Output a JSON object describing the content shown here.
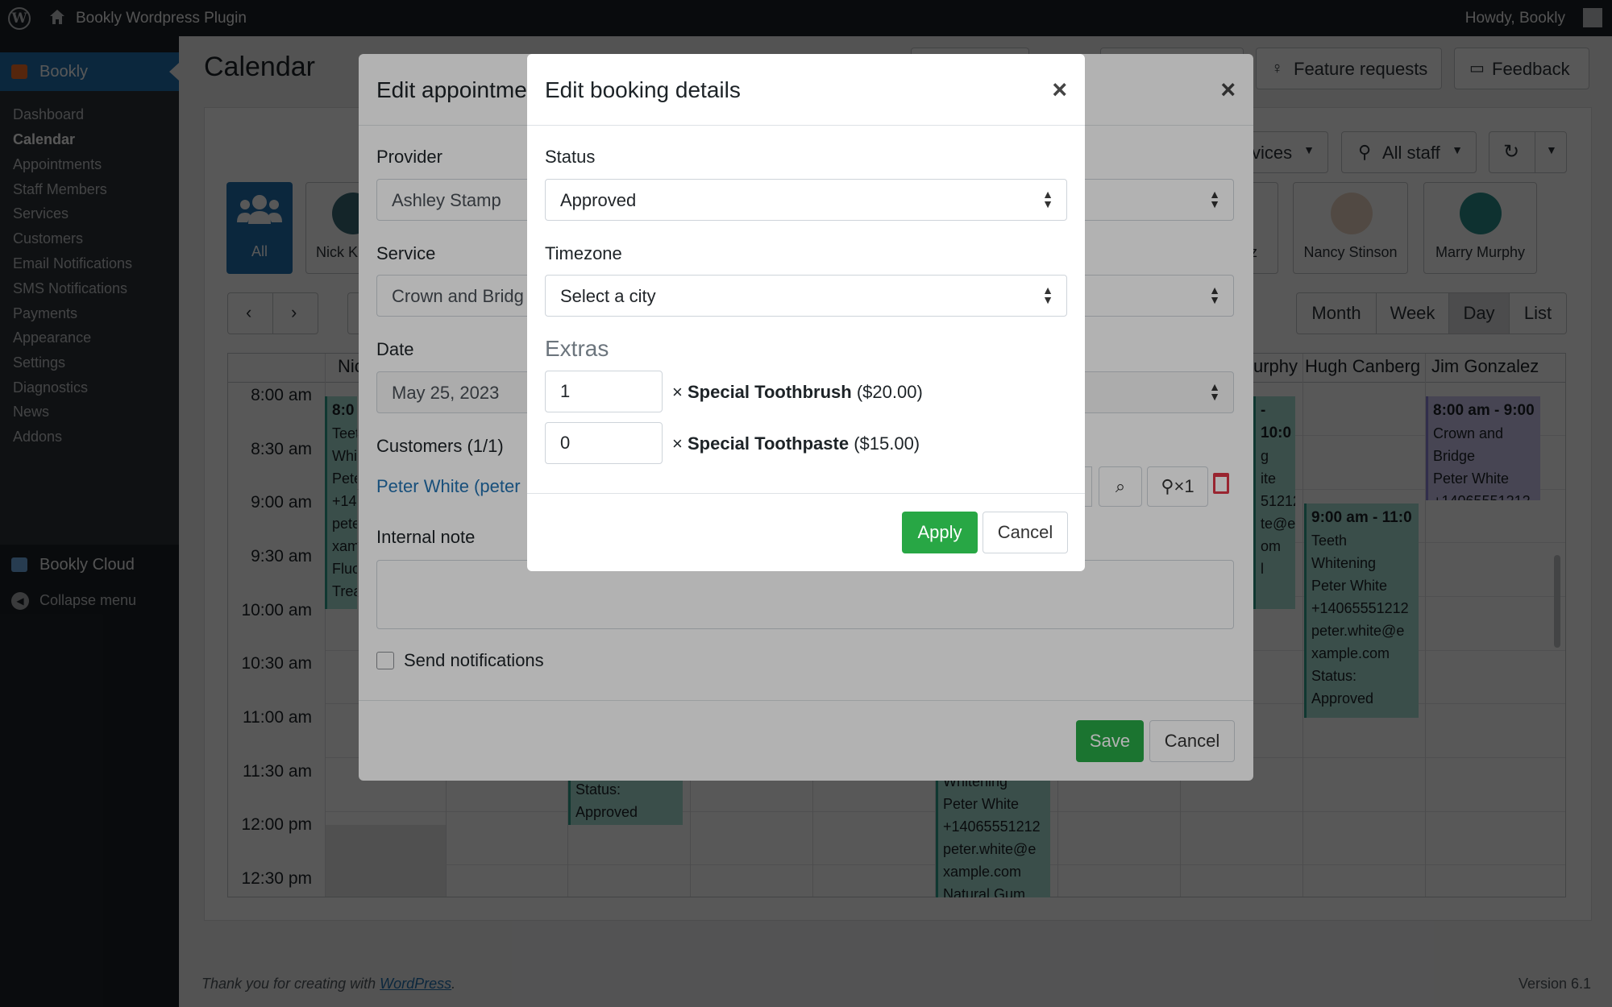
{
  "adminbar": {
    "site_name": "Bookly Wordpress Plugin",
    "howdy": "Howdy, Bookly"
  },
  "sidebar": {
    "active_menu": "Bookly",
    "items": [
      {
        "label": "Dashboard"
      },
      {
        "label": "Calendar",
        "current": true
      },
      {
        "label": "Appointments"
      },
      {
        "label": "Staff Members"
      },
      {
        "label": "Services"
      },
      {
        "label": "Customers"
      },
      {
        "label": "Email Notifications"
      },
      {
        "label": "SMS Notifications"
      },
      {
        "label": "Payments"
      },
      {
        "label": "Appearance"
      },
      {
        "label": "Settings"
      },
      {
        "label": "Diagnostics"
      },
      {
        "label": "News"
      },
      {
        "label": "Addons"
      }
    ],
    "cloud": "Bookly Cloud",
    "collapse": "Collapse menu"
  },
  "page": {
    "title": "Calendar",
    "feature_requests": "Feature requests",
    "feedback": "Feedback"
  },
  "calendar": {
    "filters": {
      "services_partial": "vices",
      "staff": "All staff"
    },
    "staff": {
      "all": "All",
      "nick_partial": "Nick K",
      "jim_partial": "ez",
      "nancy": "Nancy Stinson",
      "marry": "Marry Murphy"
    },
    "views": [
      "Month",
      "Week",
      "Day",
      "List"
    ],
    "active_view": "Day",
    "columns": {
      "nick_partial": "Nic",
      "murphy_partial": "urphy",
      "hugh": "Hugh Canberg",
      "jim": "Jim Gonzalez"
    },
    "times": [
      "8:00 am",
      "8:30 am",
      "9:00 am",
      "9:30 am",
      "10:00 am",
      "10:30 am",
      "11:00 am",
      "11:30 am",
      "12:00 pm",
      "12:30 pm"
    ],
    "appointments": {
      "a1": [
        "8:0",
        "Teet",
        "Whit",
        "Pete",
        "+140",
        "pete",
        "xam",
        "Fluo",
        "Trea"
      ],
      "a2": [
        "- 10:0",
        "g",
        "ite",
        "51212",
        "te@e",
        "om",
        "l"
      ],
      "a3": [
        "8:00 am - 9:00",
        "Crown and",
        "Bridge",
        "Peter White",
        "+14065551212"
      ],
      "a4": [
        "9:00 am - 11:0",
        "Teeth",
        "Whitening",
        "Peter White",
        "+14065551212",
        "peter.white@e",
        "xample.com",
        "Status:",
        "Approved"
      ],
      "a5": [
        "Status:",
        "Approved"
      ],
      "a6": [
        "Whitening",
        "Peter White",
        "+14065551212",
        "peter.white@e",
        "xample.com",
        "Natural Gum"
      ]
    }
  },
  "edit_appointment": {
    "title_partial": "Edit appointme",
    "provider_label": "Provider",
    "provider_value": "Ashley Stamp",
    "service_label": "Service",
    "service_value": "Crown and Bridg",
    "date_label": "Date",
    "date_value": "May 25, 2023",
    "customers_label": "Customers (1/1)",
    "customer_link": "Peter White (peter",
    "count_badge": "×1",
    "note_label": "Internal note",
    "send_notifications": "Send notifications",
    "save": "Save",
    "cancel": "Cancel"
  },
  "booking_details": {
    "title": "Edit booking details",
    "status_label": "Status",
    "status_value": "Approved",
    "timezone_label": "Timezone",
    "timezone_value": "Select a city",
    "extras_heading": "Extras",
    "extras": [
      {
        "qty": "1",
        "name": "Special Toothbrush",
        "price": "($20.00)"
      },
      {
        "qty": "0",
        "name": "Special Toothpaste",
        "price": "($15.00)"
      }
    ],
    "multiply": "×",
    "apply": "Apply",
    "cancel": "Cancel"
  },
  "footer": {
    "thanks_prefix": "Thank you for creating with",
    "thanks_link": "WordPress",
    "thanks_suffix": ".",
    "version": "Version 6.1"
  }
}
